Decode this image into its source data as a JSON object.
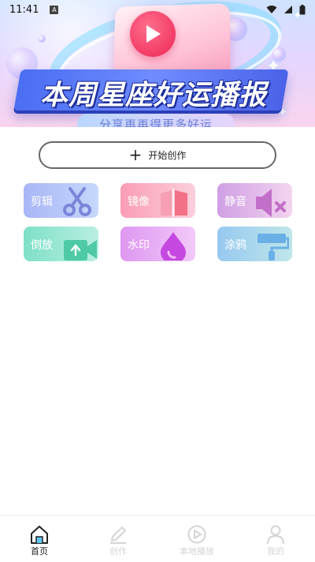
{
  "status_bar": {
    "time": "11:41",
    "notification_glyph": "A",
    "icons": [
      "wifi-icon",
      "signal-icon",
      "battery-icon"
    ]
  },
  "banner": {
    "title": "本周星座好运播报",
    "subtitle": "分享再再得更多好运"
  },
  "create_button": {
    "label": "开始创作",
    "icon": "plus-icon"
  },
  "tools": [
    {
      "label": "剪辑",
      "icon": "scissors-icon",
      "color": "#a9b6f7"
    },
    {
      "label": "镜像",
      "icon": "mirror-icon",
      "color": "#fa9db5"
    },
    {
      "label": "静音",
      "icon": "mute-speaker-icon",
      "color": "#cf9fe4"
    },
    {
      "label": "倒放",
      "icon": "reverse-video-icon",
      "color": "#7fe0c7"
    },
    {
      "label": "水印",
      "icon": "water-drop-icon",
      "color": "#de97f2"
    },
    {
      "label": "涂鸦",
      "icon": "paint-roller-icon",
      "color": "#97c9f0"
    }
  ],
  "bottom_nav": {
    "items": [
      {
        "label": "首页",
        "icon": "home-icon",
        "active": true
      },
      {
        "label": "创作",
        "icon": "pencil-icon",
        "active": false
      },
      {
        "label": "本地播放",
        "icon": "play-circle-icon",
        "active": false
      },
      {
        "label": "我的",
        "icon": "user-icon",
        "active": false
      }
    ]
  },
  "colors": {
    "accent": "#2a2a2a",
    "inactive": "#d4d4d4",
    "banner_blue": "#4a6df2",
    "play_red": "#f23b66"
  }
}
